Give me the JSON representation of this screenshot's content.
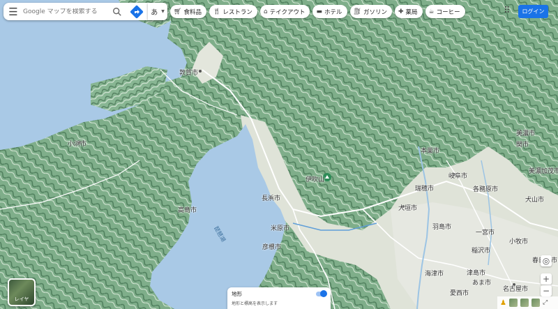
{
  "search": {
    "placeholder": "Google マップを検索する"
  },
  "ime": {
    "label": "あ"
  },
  "chips": [
    {
      "label": "食料品",
      "icon": "cart-icon"
    },
    {
      "label": "レストラン",
      "icon": "restaurant-icon"
    },
    {
      "label": "テイクアウト",
      "icon": "takeout-icon"
    },
    {
      "label": "ホテル",
      "icon": "hotel-icon"
    },
    {
      "label": "ガソリン",
      "icon": "gas-icon"
    },
    {
      "label": "薬局",
      "icon": "pharmacy-icon"
    },
    {
      "label": "コーヒー",
      "icon": "coffee-icon"
    }
  ],
  "login": {
    "label": "ログイン"
  },
  "layers": {
    "label": "レイヤ"
  },
  "terrain": {
    "title": "地形",
    "subtitle": "地形と標高を表示します"
  },
  "map_labels": {
    "tsuruga": "敦賀市",
    "obama": "小浜市",
    "nagahama": "長浜市",
    "hikone": "彦根市",
    "takashima": "高島市",
    "maibara": "米原市",
    "ogaki": "大垣市",
    "gifu": "岐阜市",
    "kakamigahara": "各務原市",
    "inuyama": "犬山市",
    "nagoya": "名古屋市",
    "ichinomiya": "一宮市",
    "hashima": "羽島市",
    "inazawa": "稲沢市",
    "motosu": "本巣市",
    "seki": "関市",
    "mino": "美濃市",
    "minokamo": "美濃加茂市",
    "kasugai": "春日井市",
    "komaki": "小牧市",
    "tsushima": "津島市",
    "ama": "あま市",
    "aisai": "愛西市",
    "kaizu": "海津市",
    "mizuho": "瑞穂市",
    "biwako": "琵琶湖",
    "ibuki": "伊吹山"
  },
  "colors": {
    "water": "#a9c9e6",
    "accent": "#1a73e8"
  }
}
